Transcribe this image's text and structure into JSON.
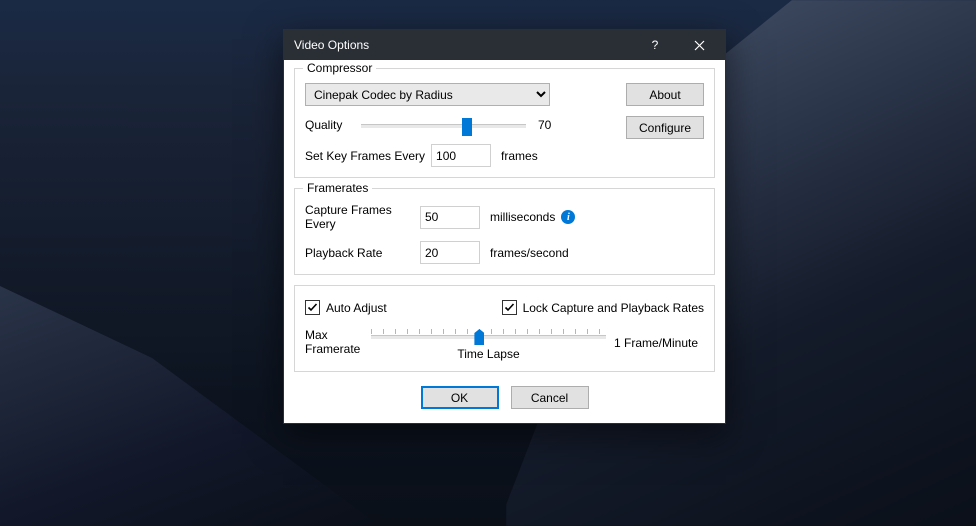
{
  "window": {
    "title": "Video Options",
    "help": "?",
    "close": "×"
  },
  "compressor": {
    "legend": "Compressor",
    "codec": "Cinepak Codec by Radius",
    "about": "About",
    "configure": "Configure",
    "quality_label": "Quality",
    "quality_value": "70",
    "keyframes_label": "Set Key Frames Every",
    "keyframes_value": "100",
    "keyframes_unit": "frames"
  },
  "framerates": {
    "legend": "Framerates",
    "capture_label": "Capture Frames Every",
    "capture_value": "50",
    "capture_unit": "milliseconds",
    "playback_label": "Playback Rate",
    "playback_value": "20",
    "playback_unit": "frames/second"
  },
  "adjust": {
    "auto_adjust": "Auto Adjust",
    "lock_rates": "Lock Capture and Playback Rates",
    "left_label": "Max\nFramerate",
    "right_label": "1 Frame/Minute",
    "caption": "Time Lapse"
  },
  "buttons": {
    "ok": "OK",
    "cancel": "Cancel"
  }
}
